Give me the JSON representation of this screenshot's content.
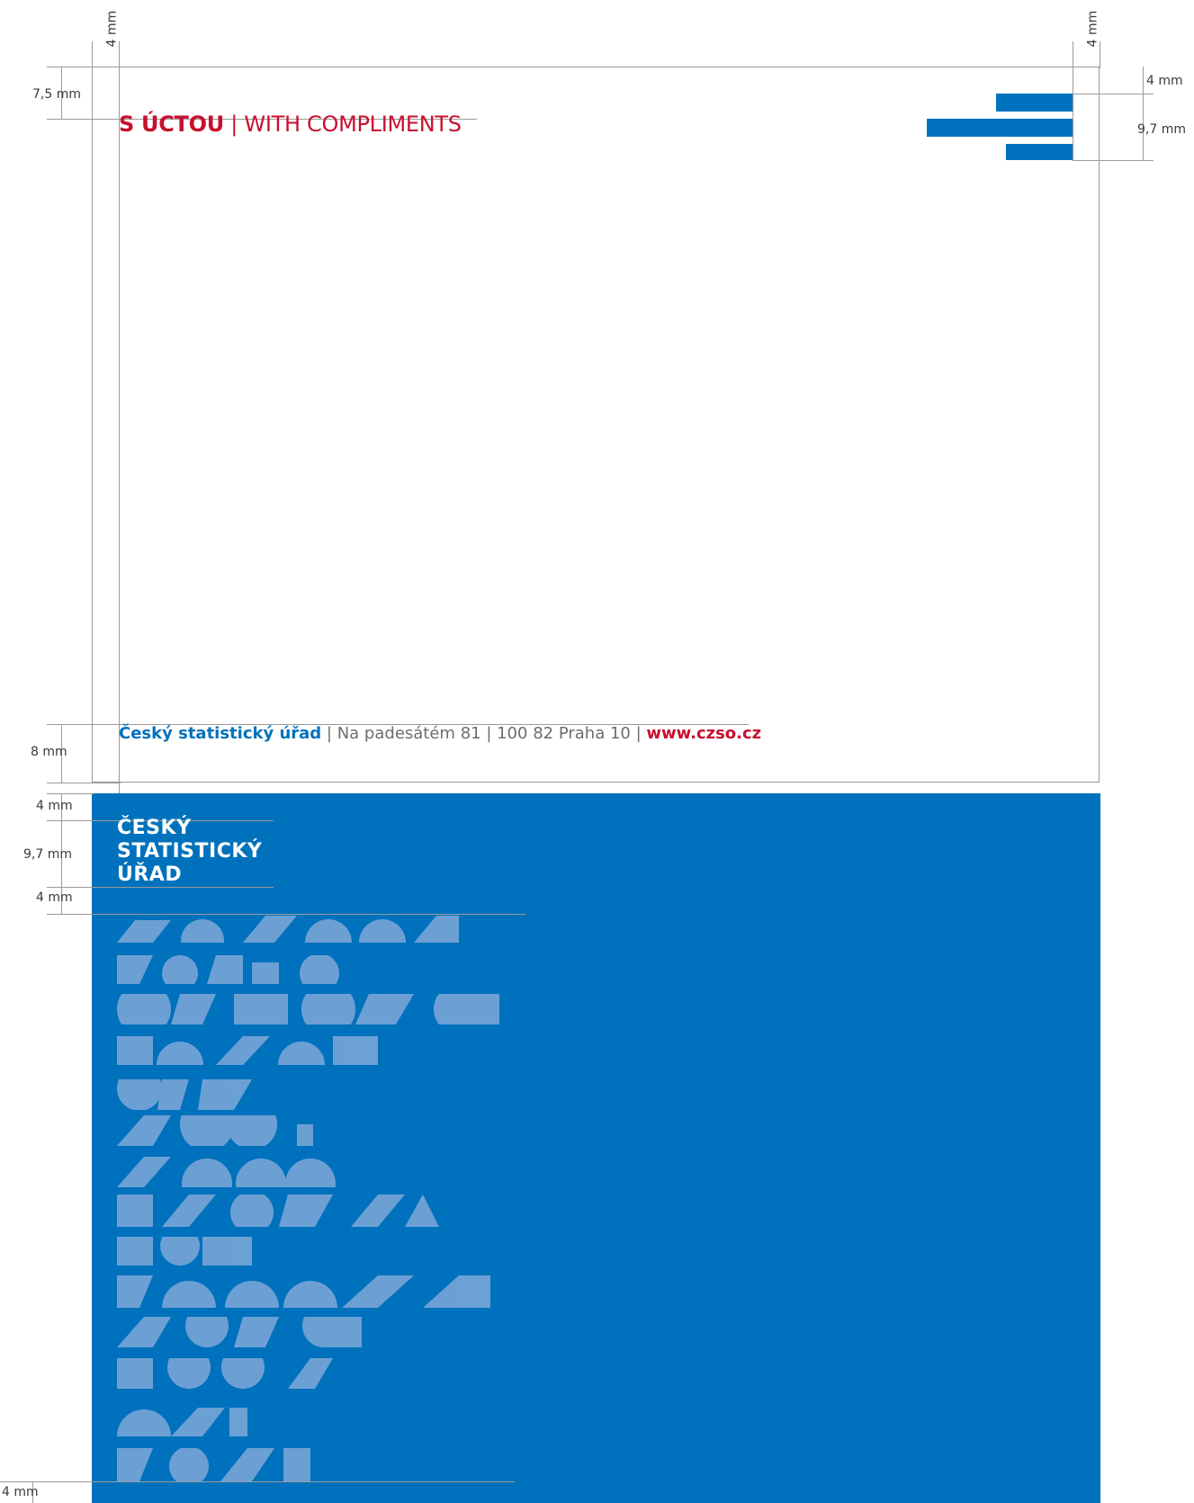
{
  "dimensions": {
    "top_left": "4 mm",
    "top_right": "4 mm",
    "left_top": "7,5 mm",
    "right_top": "4 mm",
    "right_logo": "9,7 mm",
    "left_bottom_front": "8 mm",
    "back_top": "4 mm",
    "back_logo": "9,7 mm",
    "back_logo_bottom": "4 mm",
    "back_bottom": "4 mm"
  },
  "front": {
    "title_bold": "S ÚCTOU",
    "title_separator": "|",
    "title_light": "WITH COMPLIMENTS",
    "footer_org": "Český statistický úřad",
    "footer_sep1": " | ",
    "footer_address": "Na padesátém 81",
    "footer_sep2": " | ",
    "footer_city": "100 82 Praha 10",
    "footer_sep3": " | ",
    "footer_url": "www.czso.cz"
  },
  "back": {
    "title_line1": "ČESKÝ",
    "title_line2": "STATISTICKÝ",
    "title_line3": "ÚŘAD"
  },
  "colors": {
    "brand_blue": "#0071BC",
    "brand_red": "#C8102E"
  }
}
